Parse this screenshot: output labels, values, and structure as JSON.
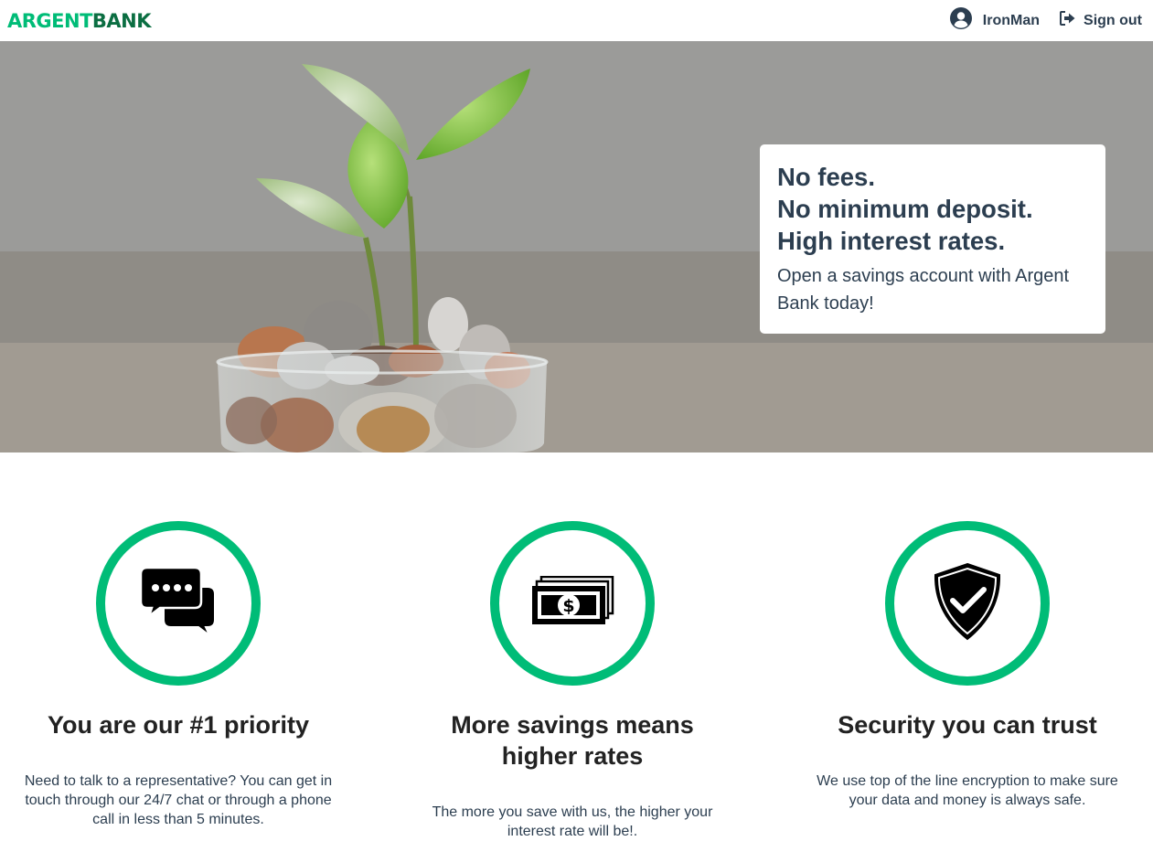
{
  "brand": {
    "part1": "ARGENT",
    "part2": "BANK"
  },
  "nav": {
    "user_name": "IronMan",
    "sign_out": "Sign out",
    "user_icon": "user-circle-icon",
    "sign_out_icon": "sign-out-icon"
  },
  "hero": {
    "subtitles": [
      "No fees.",
      "No minimum deposit.",
      "High interest rates."
    ],
    "text": "Open a savings account with Argent Bank today!"
  },
  "features": [
    {
      "icon": "chat-icon",
      "title": "You are our #1 priority",
      "text": "Need to talk to a representative? You can get in touch through our 24/7 chat or through a phone call in less than 5 minutes."
    },
    {
      "icon": "money-icon",
      "title": "More savings means higher rates",
      "text": "The more you save with us, the higher your interest rate will be!."
    },
    {
      "icon": "security-shield-icon",
      "title": "Security you can trust",
      "text": "We use top of the line encryption to make sure your data and money is always safe."
    }
  ],
  "colors": {
    "accent": "#00bc77",
    "brand_dark": "#0b6e42",
    "text": "#2c3e50"
  }
}
